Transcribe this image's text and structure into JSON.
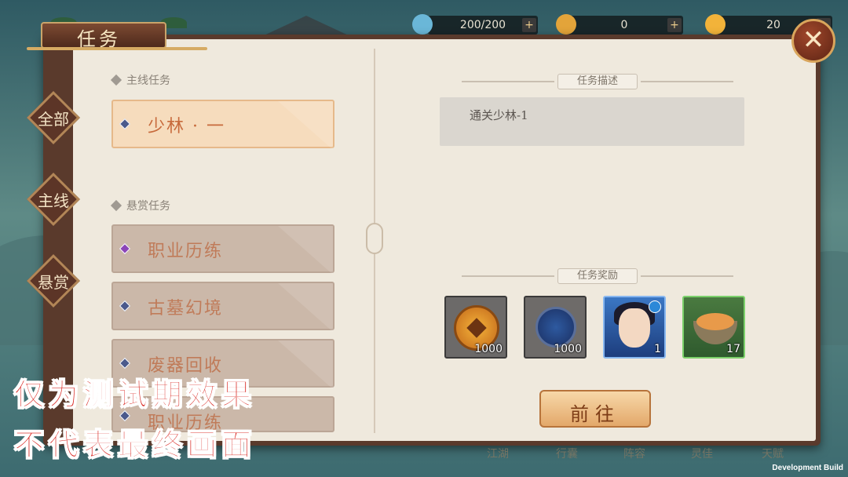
{
  "title": "任务",
  "resources": [
    {
      "name": "stamina",
      "value": "200/200"
    },
    {
      "name": "gold-ingot",
      "value": "0"
    },
    {
      "name": "flame",
      "value": "20"
    }
  ],
  "side_tabs": [
    "全部",
    "主线",
    "悬赏"
  ],
  "main_section": {
    "title": "主线任务",
    "tasks": [
      "少林 · 一"
    ]
  },
  "bounty_section": {
    "title": "悬赏任务",
    "tasks": [
      "职业历练",
      "古墓幻境",
      "废器回收",
      "职业历练"
    ]
  },
  "description": {
    "header": "任务描述",
    "text": "通关少林-1"
  },
  "rewards": {
    "header": "任务奖励",
    "items": [
      {
        "icon": "copper-coin-icon",
        "qty": "1000"
      },
      {
        "icon": "blue-token-icon",
        "qty": "1000"
      },
      {
        "icon": "hero-portrait-icon",
        "qty": "1"
      },
      {
        "icon": "food-dish-icon",
        "qty": "17"
      }
    ]
  },
  "go_button": "前往",
  "overlay_lines": [
    "仅为测试期效果",
    "不代表最终画面"
  ],
  "dev_build": "Development Build",
  "bottom_nav": [
    "江湖",
    "行囊",
    "阵容",
    "灵佳",
    "天赋"
  ]
}
